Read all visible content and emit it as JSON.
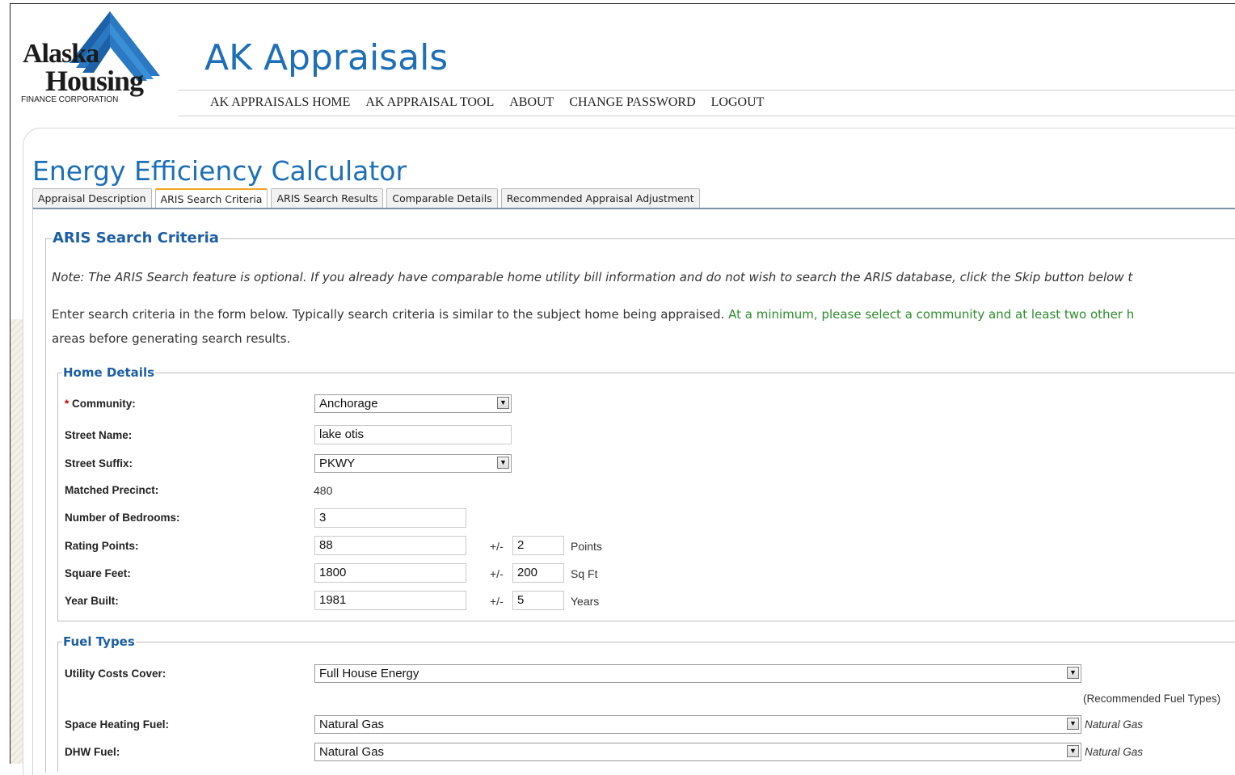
{
  "logo": {
    "line1": "Alaska",
    "line2": "Housing",
    "line3": "FINANCE CORPORATION"
  },
  "site_title": "AK Appraisals",
  "nav": [
    "AK APPRAISALS HOME",
    "AK APPRAISAL TOOL",
    "ABOUT",
    "CHANGE PASSWORD",
    "LOGOUT"
  ],
  "page_title": "Energy Efficiency Calculator",
  "tabs": [
    "Appraisal Description",
    "ARIS Search Criteria",
    "ARIS Search Results",
    "Comparable Details",
    "Recommended Appraisal Adjustment"
  ],
  "active_tab": "ARIS Search Criteria",
  "section_title": "ARIS Search Criteria",
  "note": "Note: The ARIS Search feature is optional. If you already have comparable home utility bill information and do not wish to search the ARIS database, click the Skip button below t",
  "instructions": {
    "part1": "Enter search criteria in the form below. Typically search criteria is similar to the subject home being appraised. ",
    "part2": "At a minimum, please select a community and at least two other h",
    "part3": "areas before generating search results."
  },
  "home_details": {
    "legend": "Home Details",
    "required_mark": "*",
    "community_label": "Community:",
    "community_value": "Anchorage",
    "street_name_label": "Street Name:",
    "street_name_value": "lake otis",
    "street_suffix_label": "Street Suffix:",
    "street_suffix_value": "PKWY",
    "matched_precinct_label": "Matched Precinct:",
    "matched_precinct_value": "480",
    "bedrooms_label": "Number of Bedrooms:",
    "bedrooms_value": "3",
    "rating_label": "Rating Points:",
    "rating_value": "88",
    "rating_tol": "2",
    "rating_unit": "Points",
    "sqft_label": "Square Feet:",
    "sqft_value": "1800",
    "sqft_tol": "200",
    "sqft_unit": "Sq Ft",
    "year_label": "Year Built:",
    "year_value": "1981",
    "year_tol": "5",
    "year_unit": "Years",
    "plus_minus": "+/-"
  },
  "fuel_types": {
    "legend": "Fuel Types",
    "utility_label": "Utility Costs Cover:",
    "utility_value": "Full House Energy",
    "recommended_note": "(Recommended Fuel Types)",
    "space_heating_label": "Space Heating Fuel:",
    "space_heating_value": "Natural Gas",
    "space_heating_rec": "Natural Gas",
    "dhw_label": "DHW Fuel:",
    "dhw_value": "Natural Gas",
    "dhw_rec": "Natural Gas"
  },
  "colors": {
    "brand_blue": "#1d6fb8",
    "legend_blue": "#1d5fa5",
    "green_text": "#2e8b2e",
    "tab_active_accent": "#f4a323",
    "required_red": "#cc0000"
  }
}
